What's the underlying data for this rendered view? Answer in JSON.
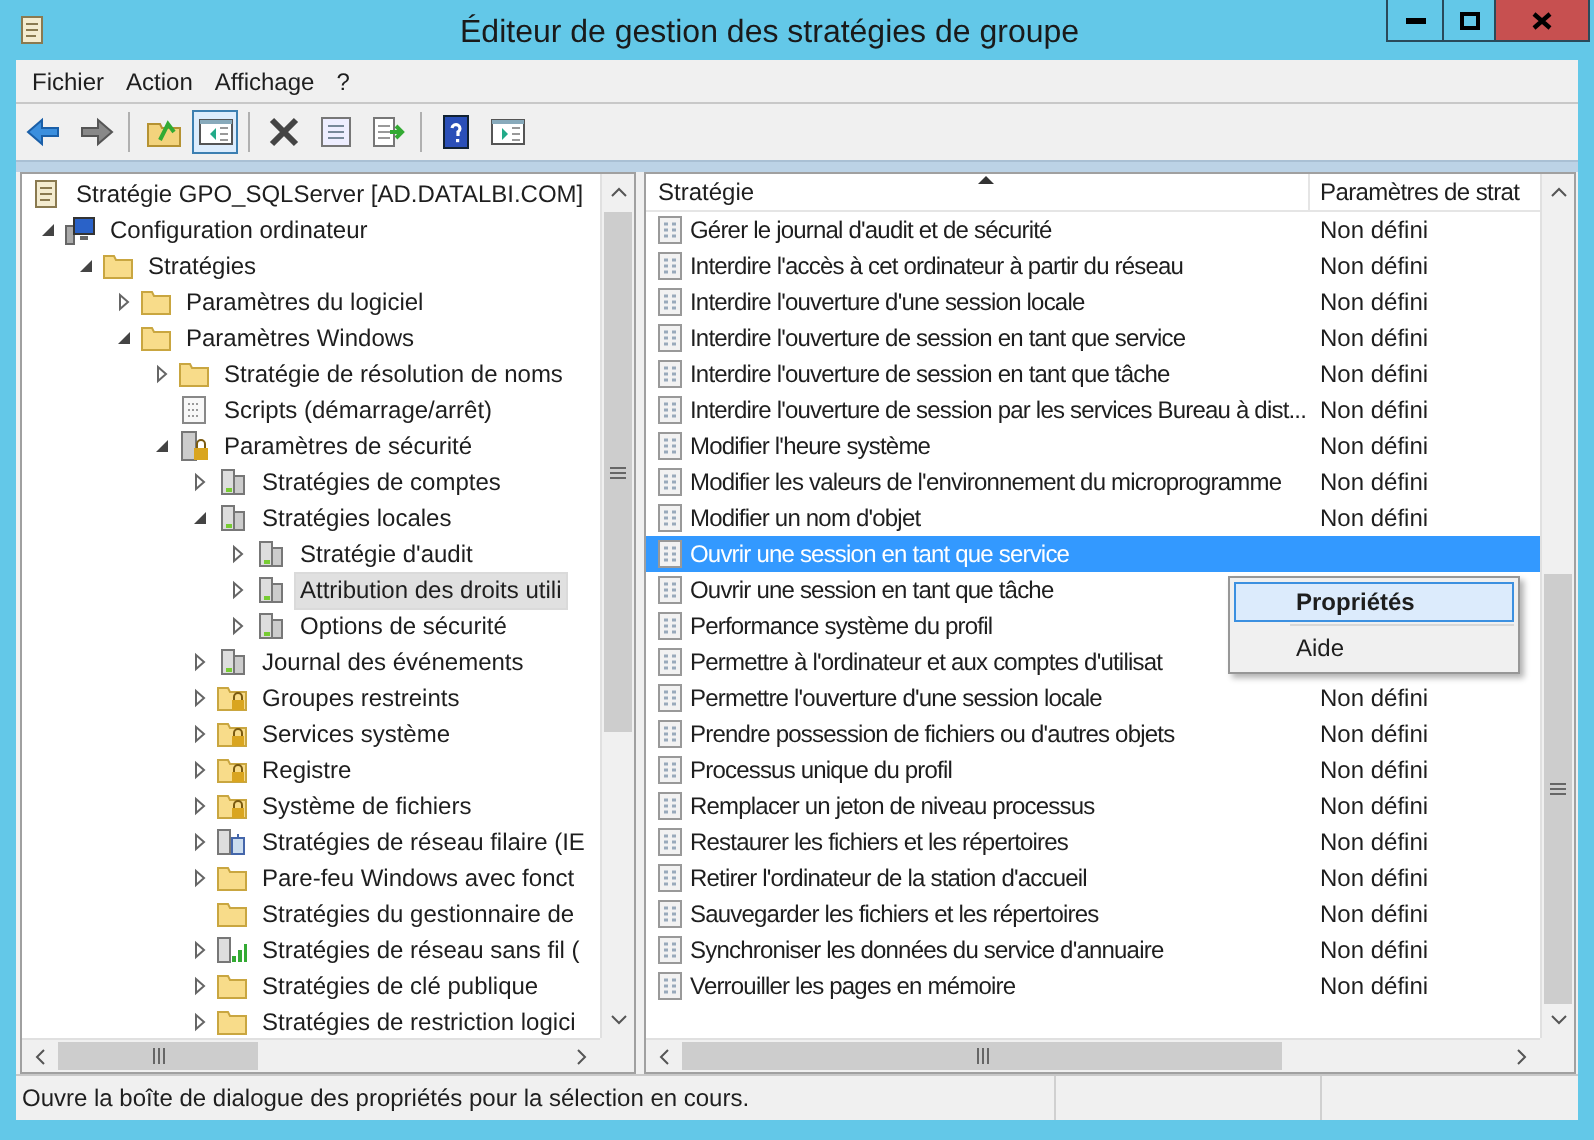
{
  "window": {
    "title": "Éditeur de gestion des stratégies de groupe"
  },
  "menu": [
    "Fichier",
    "Action",
    "Affichage",
    "?"
  ],
  "toolbar": [
    {
      "kind": "back",
      "pressed": false
    },
    {
      "kind": "forward",
      "pressed": false
    },
    {
      "kind": "separator"
    },
    {
      "kind": "up",
      "pressed": false
    },
    {
      "kind": "console-tree",
      "pressed": true
    },
    {
      "kind": "separator"
    },
    {
      "kind": "delete",
      "pressed": false
    },
    {
      "kind": "properties",
      "pressed": false
    },
    {
      "kind": "export",
      "pressed": false
    },
    {
      "kind": "separator"
    },
    {
      "kind": "help",
      "pressed": false
    },
    {
      "kind": "action-pane",
      "pressed": false
    }
  ],
  "tree": [
    {
      "label": "Stratégie GPO_SQLServer [AD.DATALBI.COM]",
      "kind": "document",
      "selected": false,
      "children": [
        {
          "label": "Configuration ordinateur",
          "kind": "computer",
          "expanded": true,
          "selected": false,
          "children": [
            {
              "label": "Stratégies",
              "kind": "folder",
              "expanded": true,
              "selected": false,
              "children": [
                {
                  "label": "Paramètres du logiciel",
                  "kind": "folder",
                  "expanded": false,
                  "selected": false
                },
                {
                  "label": "Paramètres Windows",
                  "kind": "folder",
                  "expanded": true,
                  "selected": false,
                  "children": [
                    {
                      "label": "Stratégie de résolution de noms",
                      "kind": "folder",
                      "expanded": false,
                      "selected": false
                    },
                    {
                      "label": "Scripts (démarrage/arrêt)",
                      "kind": "scripts",
                      "selected": false
                    },
                    {
                      "label": "Paramètres de sécurité",
                      "kind": "security",
                      "expanded": true,
                      "selected": false,
                      "children": [
                        {
                          "label": "Stratégies de comptes",
                          "kind": "policy",
                          "expanded": false,
                          "selected": false
                        },
                        {
                          "label": "Stratégies locales",
                          "kind": "policy",
                          "expanded": true,
                          "selected": false,
                          "children": [
                            {
                              "label": "Stratégie d'audit",
                              "kind": "policy",
                              "expanded": false,
                              "selected": false
                            },
                            {
                              "label": "Attribution des droits utili",
                              "kind": "policy",
                              "expanded": false,
                              "selected": true
                            },
                            {
                              "label": "Options de sécurité",
                              "kind": "policy",
                              "expanded": false,
                              "selected": false
                            }
                          ]
                        },
                        {
                          "label": "Journal des événements",
                          "kind": "policy",
                          "expanded": false,
                          "selected": false
                        },
                        {
                          "label": "Groupes restreints",
                          "kind": "folder-lock",
                          "expanded": false,
                          "selected": false
                        },
                        {
                          "label": "Services système",
                          "kind": "folder-lock",
                          "expanded": false,
                          "selected": false
                        },
                        {
                          "label": "Registre",
                          "kind": "folder-lock",
                          "expanded": false,
                          "selected": false
                        },
                        {
                          "label": "Système de fichiers",
                          "kind": "folder-lock",
                          "expanded": false,
                          "selected": false
                        },
                        {
                          "label": "Stratégies de réseau filaire (IE",
                          "kind": "network",
                          "expanded": false,
                          "selected": false
                        },
                        {
                          "label": "Pare-feu Windows avec fonct",
                          "kind": "folder",
                          "expanded": false,
                          "selected": false
                        },
                        {
                          "label": "Stratégies du gestionnaire de",
                          "kind": "folder",
                          "selected": false
                        },
                        {
                          "label": "Stratégies de réseau sans fil (",
                          "kind": "wireless",
                          "expanded": false,
                          "selected": false
                        },
                        {
                          "label": "Stratégies de clé publique",
                          "kind": "folder",
                          "expanded": false,
                          "selected": false
                        },
                        {
                          "label": "Stratégies de restriction logici",
                          "kind": "folder",
                          "expanded": false,
                          "selected": false
                        }
                      ]
                    }
                  ]
                }
              ]
            }
          ]
        }
      ]
    }
  ],
  "list": {
    "columns": [
      "Stratégie",
      "Paramètres de strat"
    ],
    "rows": [
      {
        "name": "Gérer le journal d'audit et de sécurité",
        "setting": "Non défini",
        "selected": false
      },
      {
        "name": "Interdire l'accès à cet ordinateur à partir du réseau",
        "setting": "Non défini",
        "selected": false
      },
      {
        "name": "Interdire l'ouverture d'une session locale",
        "setting": "Non défini",
        "selected": false
      },
      {
        "name": "Interdire l'ouverture de session en tant que service",
        "setting": "Non défini",
        "selected": false
      },
      {
        "name": "Interdire l'ouverture de session en tant que tâche",
        "setting": "Non défini",
        "selected": false
      },
      {
        "name": "Interdire l'ouverture de session par les services Bureau à dist...",
        "setting": "Non défini",
        "selected": false
      },
      {
        "name": "Modifier l'heure système",
        "setting": "Non défini",
        "selected": false
      },
      {
        "name": "Modifier les valeurs de l'environnement du microprogramme",
        "setting": "Non défini",
        "selected": false
      },
      {
        "name": "Modifier un nom d'objet",
        "setting": "Non défini",
        "selected": false
      },
      {
        "name": "Ouvrir une session en tant que service",
        "selected": true
      },
      {
        "name": "Ouvrir une session en tant que tâche",
        "selected": false
      },
      {
        "name": "Performance système du profil",
        "selected": false
      },
      {
        "name": "Permettre à l'ordinateur et aux comptes d'utilisat",
        "selected": false
      },
      {
        "name": "Permettre l'ouverture d'une session locale",
        "setting": "Non défini",
        "selected": false
      },
      {
        "name": "Prendre possession de fichiers ou d'autres objets",
        "setting": "Non défini",
        "selected": false
      },
      {
        "name": "Processus unique du profil",
        "setting": "Non défini",
        "selected": false
      },
      {
        "name": "Remplacer un jeton de niveau processus",
        "setting": "Non défini",
        "selected": false
      },
      {
        "name": "Restaurer les fichiers et les répertoires",
        "setting": "Non défini",
        "selected": false
      },
      {
        "name": "Retirer l'ordinateur de la station d'accueil",
        "setting": "Non défini",
        "selected": false
      },
      {
        "name": "Sauvegarder les fichiers et les répertoires",
        "setting": "Non défini",
        "selected": false
      },
      {
        "name": "Synchroniser les données du service d'annuaire",
        "setting": "Non défini",
        "selected": false
      },
      {
        "name": "Verrouiller les pages en mémoire",
        "setting": "Non défini",
        "selected": false
      }
    ]
  },
  "context_menu": [
    {
      "label": "Propriétés",
      "selected": true
    },
    {
      "label": "Aide",
      "selected": false
    }
  ],
  "status_bar": "Ouvre la boîte de dialogue des propriétés pour la sélection en cours."
}
